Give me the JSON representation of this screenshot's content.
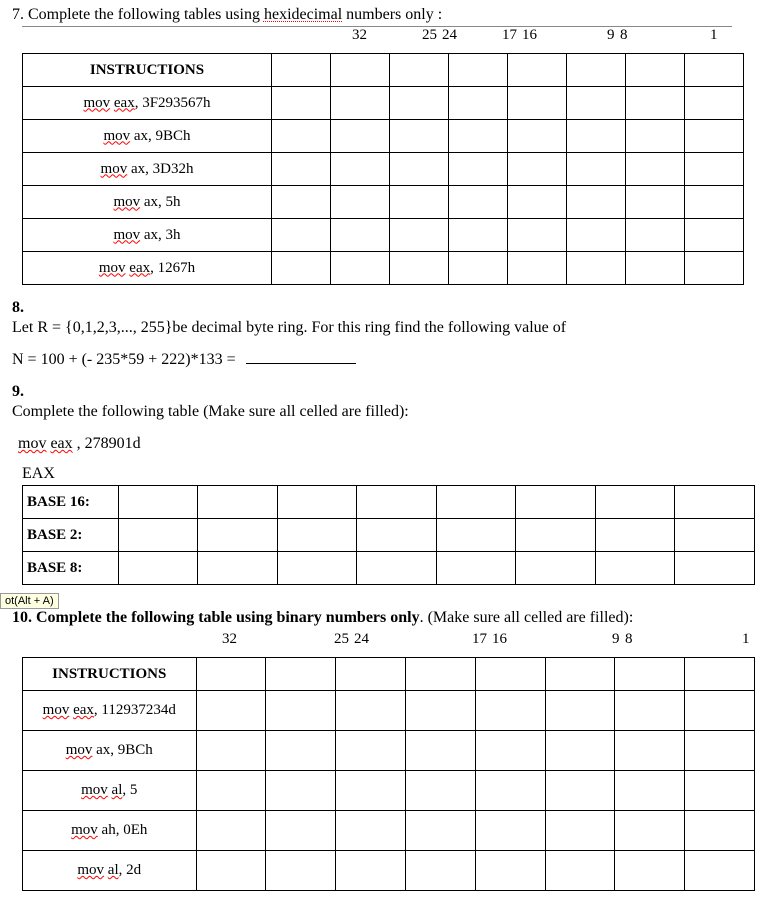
{
  "q7": {
    "prompt_prefix": "7.  Complete the following tables using ",
    "prompt_underlined": "hexidecimal",
    "prompt_suffix": " numbers  only :",
    "ruler": {
      "p32": "32",
      "p25": "25",
      "p24": "24",
      "p17": "17",
      "p16": "16",
      "p9": "9",
      "p8": "8",
      "p1": "1"
    },
    "header": "INSTRUCTIONS",
    "rows": [
      {
        "pre": "mov",
        "mid": " ",
        "post": "eax",
        "rest": ", 3F293567h"
      },
      {
        "pre": "mov",
        "mid": " ",
        "post": "ax",
        "rest": ", 9BCh"
      },
      {
        "pre": "mov",
        "mid": " ",
        "post": "ax",
        "rest": ", 3D32h"
      },
      {
        "pre": "mov",
        "mid": " ",
        "post": "ax",
        "rest": ", 5h"
      },
      {
        "pre": "mov",
        "mid": "  ",
        "post": "ax",
        "rest": ", 3h"
      },
      {
        "pre": "mov",
        "mid": " ",
        "post": "eax",
        "rest": ", 1267h"
      }
    ]
  },
  "q8": {
    "num": "8.",
    "line1": "Let R = {0,1,2,3,..., 255}be decimal byte ring. For this ring find the following value of",
    "line2": "N = 100  + (- 235*59 + 222)*133 ="
  },
  "q9": {
    "num": "9.",
    "line1": " Complete the following table (Make sure all celled are filled):",
    "instr_pre": "mov",
    "instr_post": "eax",
    "instr_rest": " , 278901d",
    "reg": "EAX",
    "rows": [
      "BASE 16:",
      "BASE 2:",
      "BASE 8:"
    ]
  },
  "tooltip": "ot(Alt + A)",
  "q10": {
    "prompt_prefix": "10.  Complete the following table using ",
    "prompt_bold": "binary numbers only",
    "prompt_suffix": ". (Make sure all celled are filled):",
    "ruler": {
      "p32": "32",
      "p25": "25",
      "p24": "24",
      "p17": "17",
      "p16": "16",
      "p9": "9",
      "p8": "8",
      "p1": "1"
    },
    "header": "INSTRUCTIONS",
    "rows": [
      {
        "pre": "mov",
        "post": "eax",
        "rest": ", 112937234d"
      },
      {
        "pre": "mov",
        "post": "ax",
        "rest": ", 9BCh"
      },
      {
        "pre": "mov",
        "post": "al",
        "rest": ", 5"
      },
      {
        "pre": "mov",
        "post": "ah",
        "rest": ", 0Eh"
      },
      {
        "pre": "mov",
        "post": "al",
        "rest": ", 2d"
      }
    ]
  }
}
